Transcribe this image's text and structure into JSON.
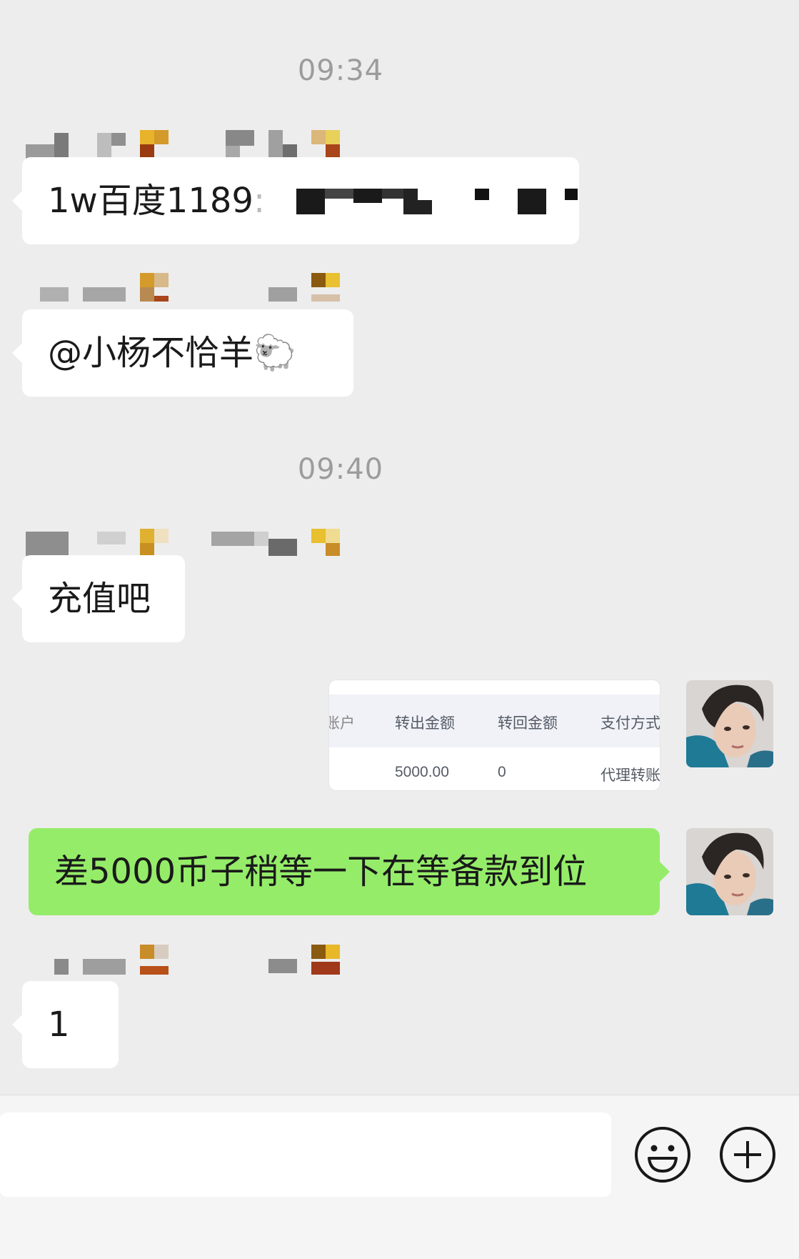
{
  "timestamps": [
    "09:34",
    "09:40"
  ],
  "messages": [
    {
      "text": "1w百度1189",
      "suffix": ":"
    },
    {
      "text": "@小杨不恰羊🐑"
    },
    {
      "text": "充值吧"
    },
    {
      "image": {
        "headers": [
          "账户",
          "转出金额",
          "转回金额",
          "支付方式"
        ],
        "cells": [
          "5000.00",
          "0",
          "代理转账"
        ]
      }
    },
    {
      "text": "差5000币子稍等一下在等备款到位"
    },
    {
      "text": "1"
    }
  ],
  "input": {
    "value": ""
  },
  "icons": {
    "emoji": "smiley-face-icon",
    "more": "plus-circle-icon"
  },
  "colors": {
    "background": "#ededed",
    "own_bubble": "#95ec69",
    "other_bubble": "#ffffff",
    "timestamp": "#9c9c9c"
  }
}
